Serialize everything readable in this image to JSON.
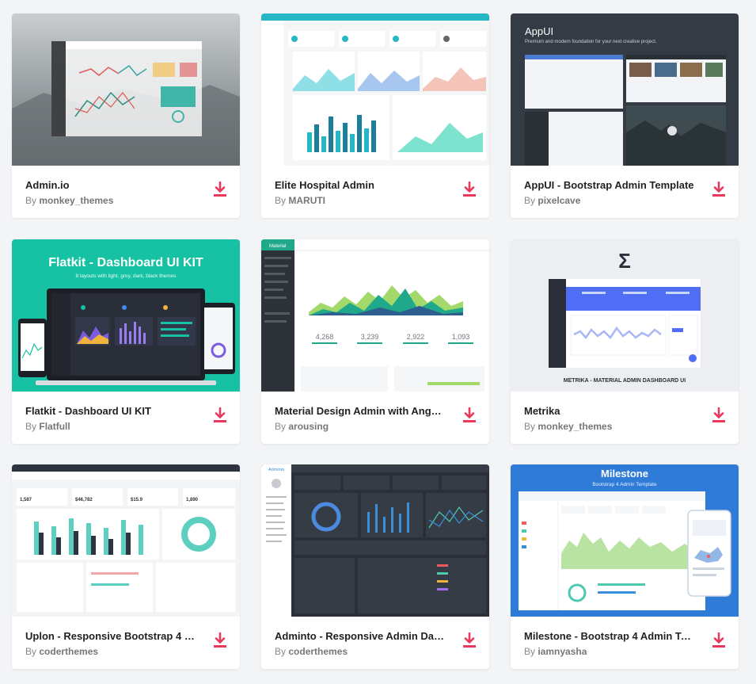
{
  "by_prefix": "By",
  "icons": {
    "download": "download-icon"
  },
  "colors": {
    "download": "#e8395c"
  },
  "cards": [
    {
      "title": "Admin.io",
      "author": "monkey_themes"
    },
    {
      "title": "Elite Hospital Admin",
      "author": "MARUTI"
    },
    {
      "title": "AppUI - Bootstrap Admin Template",
      "author": "pixelcave",
      "thumb": {
        "heading": "AppUI",
        "tagline": "Premium and modern foundation for your next creative project."
      }
    },
    {
      "title": "Flatkit - Dashboard UI KIT",
      "author": "Flatfull",
      "thumb": {
        "heading": "Flatkit - Dashboard UI KIT",
        "tagline": "8 layouts with light, grey, dark, black themes"
      }
    },
    {
      "title": "Material Design Admin with Angu...",
      "author": "arousing",
      "thumb": {
        "brand": "Material",
        "stats": [
          "4,268",
          "3,239",
          "2,922",
          "1,093"
        ]
      }
    },
    {
      "title": "Metrika",
      "author": "monkey_themes",
      "thumb": {
        "logo": "Σ",
        "caption": "METRIKA - MATERIAL ADMIN DASHBOARD UI"
      }
    },
    {
      "title": "Uplon - Responsive Bootstrap 4 W...",
      "author": "coderthemes",
      "thumb": {
        "stats": [
          "1,587",
          "$46,782",
          "$15.9",
          "1,890"
        ]
      }
    },
    {
      "title": "Adminto - Responsive Admin Dash...",
      "author": "coderthemes",
      "thumb": {
        "brand": "Adminto"
      }
    },
    {
      "title": "Milestone - Bootstrap 4 Admin Te...",
      "author": "iamnyasha",
      "thumb": {
        "heading": "Milestone",
        "tagline": "Bootstrap 4 Admin Template"
      }
    }
  ]
}
